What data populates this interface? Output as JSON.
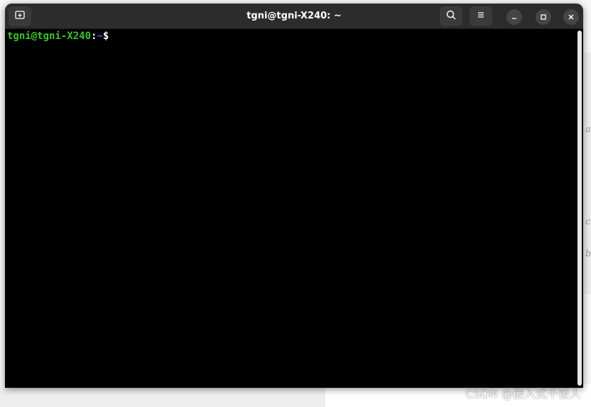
{
  "window": {
    "title": "tgni@tgni-X240: ~"
  },
  "terminal": {
    "prompt_user_host": "tgni@tgni-X240",
    "prompt_colon": ":",
    "prompt_path": "~",
    "prompt_symbol": "$"
  },
  "icons": {
    "new_tab": "new-tab-icon",
    "search": "search-icon",
    "menu": "hamburger-menu-icon",
    "minimize": "minimize-icon",
    "maximize": "maximize-icon",
    "close": "close-icon"
  },
  "background": {
    "fragments": [
      "a",
      "c",
      "b"
    ],
    "watermark": "CSDN @嵌入式干饭人"
  },
  "colors": {
    "prompt_green": "#33c41f",
    "prompt_blue": "#2a6fe6",
    "titlebar": "#2c2c2c",
    "terminal_bg": "#000000"
  }
}
